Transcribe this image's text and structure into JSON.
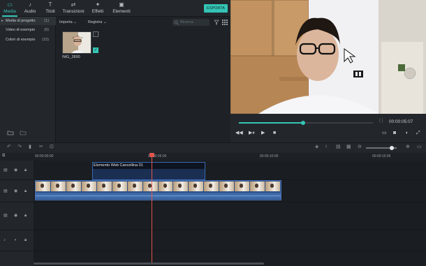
{
  "tabs": [
    {
      "label": "Media",
      "icon": "folder-icon",
      "glyph": "▭"
    },
    {
      "label": "Audio",
      "icon": "music-note-icon",
      "glyph": "♪"
    },
    {
      "label": "Titoli",
      "icon": "text-icon",
      "glyph": "T"
    },
    {
      "label": "Transizioni",
      "icon": "transition-icon",
      "glyph": "⇄"
    },
    {
      "label": "Effetti",
      "icon": "effects-icon",
      "glyph": "✦"
    },
    {
      "label": "Elementi",
      "icon": "image-icon",
      "glyph": "▣"
    }
  ],
  "export_label": "ESPORTA",
  "sidebar": {
    "items": [
      {
        "label": "Media di progetto",
        "count": "(1)"
      },
      {
        "label": "Video di esempio",
        "count": "(6)"
      },
      {
        "label": "Colori di esempio",
        "count": "(15)"
      }
    ]
  },
  "media": {
    "import_label": "Importa",
    "record_label": "Registra",
    "search_placeholder": "Ricerca",
    "thumb_name": "IMG_2890"
  },
  "preview": {
    "timecode": "00:00:05:07",
    "progress": 0.48
  },
  "timeline": {
    "ruler": [
      "00:00:00:00",
      "00:00:05:00",
      "00:00:10:00",
      "00:00:15:00"
    ],
    "title_clip": "Elemento Web Cancellina 01",
    "zoom": 0.85
  },
  "colors": {
    "accent": "#35c4b5",
    "playhead": "#e0564f",
    "clip": "#2e4f86"
  }
}
